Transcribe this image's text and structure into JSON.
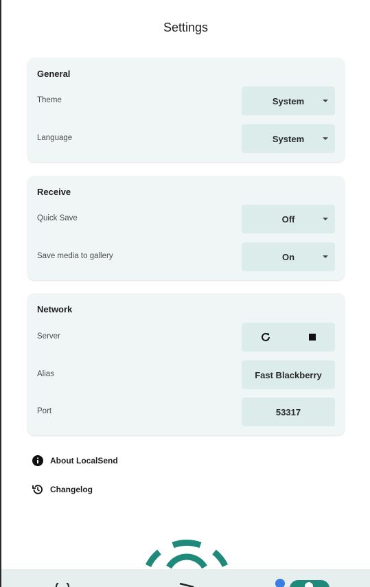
{
  "page": {
    "title": "Settings"
  },
  "general": {
    "title": "General",
    "theme_label": "Theme",
    "theme_value": "System",
    "language_label": "Language",
    "language_value": "System"
  },
  "receive": {
    "title": "Receive",
    "quick_save_label": "Quick Save",
    "quick_save_value": "Off",
    "save_media_label": "Save media to gallery",
    "save_media_value": "On"
  },
  "network": {
    "title": "Network",
    "server_label": "Server",
    "server_icons": [
      "refresh-icon",
      "stop-icon"
    ],
    "alias_label": "Alias",
    "alias_value": "Fast Blackberry",
    "port_label": "Port",
    "port_value": "53317"
  },
  "links": {
    "about": "About LocalSend",
    "changelog": "Changelog"
  },
  "colors": {
    "card_bg": "#f0f6f6",
    "control_bg": "#dbecea",
    "accent": "#1f8a7a"
  }
}
